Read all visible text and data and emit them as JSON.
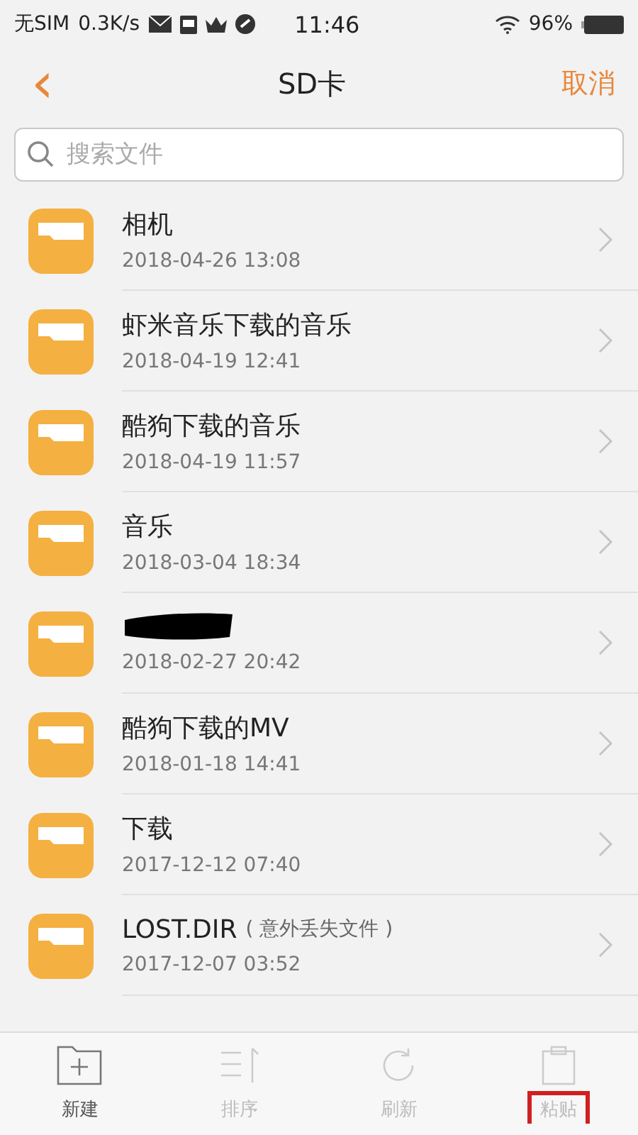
{
  "status_bar": {
    "carrier": "无SIM",
    "speed": "0.3K/s",
    "time": "11:46",
    "battery": "96%"
  },
  "nav": {
    "back": "‹",
    "title": "SD卡",
    "cancel": "取消"
  },
  "search": {
    "placeholder": "搜索文件"
  },
  "files": [
    {
      "kind": "folder",
      "name": "相机",
      "date": "2018-04-26 13:08"
    },
    {
      "kind": "folder",
      "name": "虾米音乐下载的音乐",
      "date": "2018-04-19 12:41"
    },
    {
      "kind": "folder",
      "name": "酷狗下载的音乐",
      "date": "2018-04-19 11:57"
    },
    {
      "kind": "folder",
      "name": "音乐",
      "date": "2018-03-04 18:34"
    },
    {
      "kind": "redacted",
      "date": "2018-02-27 20:42"
    },
    {
      "kind": "folder",
      "name": "酷狗下载的MV",
      "date": "2018-01-18 14:41"
    },
    {
      "kind": "folder",
      "name": "下载",
      "date": "2017-12-12 07:40"
    },
    {
      "kind": "folder",
      "name": "LOST.DIR",
      "note": "( 意外丢失文件 )",
      "date": "2017-12-07 03:52"
    }
  ],
  "toolbar": [
    {
      "kind": "new",
      "label": "新建",
      "disabled": false,
      "highlighted": false
    },
    {
      "kind": "sort",
      "label": "排序",
      "disabled": true,
      "highlighted": false
    },
    {
      "kind": "refresh",
      "label": "刷新",
      "disabled": true,
      "highlighted": false
    },
    {
      "kind": "paste",
      "label": "粘贴",
      "disabled": true,
      "highlighted": true
    }
  ]
}
